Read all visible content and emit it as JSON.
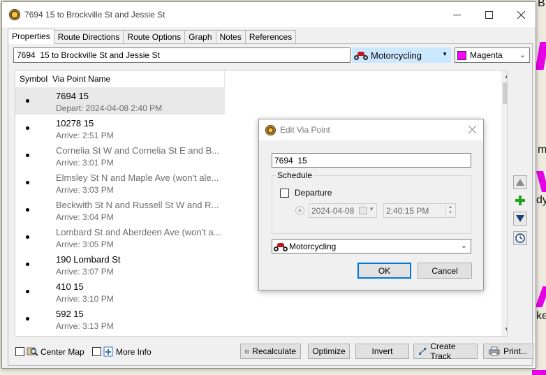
{
  "window": {
    "title": "7694  15 to Brockville St and Jessie St"
  },
  "tabs": [
    {
      "label": "Properties"
    },
    {
      "label": "Route Directions"
    },
    {
      "label": "Route Options"
    },
    {
      "label": "Graph"
    },
    {
      "label": "Notes"
    },
    {
      "label": "References"
    }
  ],
  "properties": {
    "name_value": "7694  15 to Brockville St and Jessie St",
    "mode": "Motorcycling",
    "color_name": "Magenta",
    "color_hex": "#ff00ff"
  },
  "list": {
    "col_symbol": "Symbol",
    "col_name": "Via Point Name",
    "rows": [
      {
        "name": "7694  15",
        "sub": "Depart: 2024-04-08 2:40 PM"
      },
      {
        "name": "10278  15",
        "sub": "Arrive: 2:51 PM"
      },
      {
        "name": "Cornelia St W and Cornelia St E and B...",
        "sub": "Arrive: 3:01 PM"
      },
      {
        "name": "Elmsley St N and Maple Ave (won't ale...",
        "sub": "Arrive: 3:03 PM"
      },
      {
        "name": "Beckwith St N and Russell St W and R...",
        "sub": "Arrive: 3:04 PM"
      },
      {
        "name": "Lombard St and Aberdeen Ave (won't a...",
        "sub": "Arrive: 3:05 PM"
      },
      {
        "name": "190 Lombard St",
        "sub": "Arrive: 3:07 PM"
      },
      {
        "name": "410  15",
        "sub": "Arrive: 3:10 PM"
      },
      {
        "name": "592  15",
        "sub": "Arrive: 3:13 PM"
      }
    ]
  },
  "bottom": {
    "center_map": "Center Map",
    "more_info": "More Info",
    "recalculate": "Recalculate",
    "optimize": "Optimize",
    "invert": "Invert",
    "create_track": "Create Track",
    "print": "Print..."
  },
  "dialog": {
    "title": "Edit Via Point",
    "name_value": "7694  15",
    "schedule_label": "Schedule",
    "departure_label": "Departure",
    "date": "2024-04-08",
    "time": "2:40:15 PM",
    "mode": "Motorcycling",
    "ok": "OK",
    "cancel": "Cancel"
  },
  "map": {
    "label_1": "B",
    "label_2": "m",
    "label_3": "dy",
    "label_4": "ke"
  }
}
